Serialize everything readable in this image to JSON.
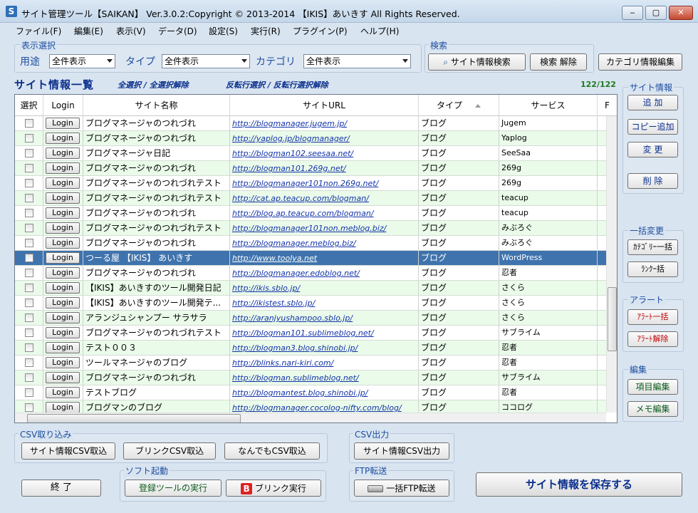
{
  "window": {
    "title": "サイト管理ツール【SAIKAN】 Ver.3.0.2:Copyright © 2013-2014 【IKIS】あいきす All Rights Reserved.",
    "icon_glyph": "S"
  },
  "menu": [
    "ファイル(F)",
    "編集(E)",
    "表示(V)",
    "データ(D)",
    "設定(S)",
    "実行(R)",
    "プラグイン(P)",
    "ヘルプ(H)"
  ],
  "display_select": {
    "group_label": "表示選択",
    "usage_label": "用途",
    "usage_value": "全件表示",
    "type_label": "タイプ",
    "type_value": "全件表示",
    "category_label": "カテゴリ",
    "category_value": "全件表示"
  },
  "search": {
    "group_label": "検索",
    "search_button": "サイト情報検索",
    "clear_button": "検索 解除"
  },
  "category_edit_button": "カテゴリ情報編集",
  "list": {
    "title": "サイト情報一覧",
    "select_all": "全選択 / 全選択解除",
    "invert": "反転行選択 / 反転行選択解除",
    "count": "122/122",
    "columns": [
      "選択",
      "Login",
      "サイト名称",
      "サイトURL",
      "タイプ",
      "サービス",
      "F"
    ],
    "login_label": "Login",
    "rows": [
      {
        "name": "ブログマネージャのつれづれ",
        "url": "http://blogmanager.jugem.jp/",
        "type": "ブログ",
        "service": "Jugem"
      },
      {
        "name": "ブログマネージャのつれづれ",
        "url": "http://yaplog.jp/blogmanager/",
        "type": "ブログ",
        "service": "Yaplog"
      },
      {
        "name": "ブログマネージャ日記",
        "url": "http://blogman102.seesaa.net/",
        "type": "ブログ",
        "service": "SeeSaa"
      },
      {
        "name": "ブログマネージャのつれづれ",
        "url": "http://blogman101.269g.net/",
        "type": "ブログ",
        "service": "269g"
      },
      {
        "name": "ブログマネージャのつれづれテスト",
        "url": "http://blogmanager101non.269g.net/",
        "type": "ブログ",
        "service": "269g"
      },
      {
        "name": "ブログマネージャのつれづれテスト",
        "url": "http://cat.ap.teacup.com/blogman/",
        "type": "ブログ",
        "service": "teacup"
      },
      {
        "name": "ブログマネージャのつれづれ",
        "url": "http://blog.ap.teacup.com/blogman/",
        "type": "ブログ",
        "service": "teacup"
      },
      {
        "name": "ブログマネージャのつれづれテスト",
        "url": "http://blogmanager101non.meblog.biz/",
        "type": "ブログ",
        "service": "みぶろぐ"
      },
      {
        "name": "ブログマネージャのつれづれ",
        "url": "http://blogmanager.meblog.biz/",
        "type": "ブログ",
        "service": "みぶろぐ"
      },
      {
        "name": "つーる屋 【IKIS】 あいきす",
        "url": "http://www.toolya.net",
        "type": "ブログ",
        "service": "WordPress"
      },
      {
        "name": "ブログマネージャのつれづれ",
        "url": "http://blogmanager.edoblog.net/",
        "type": "ブログ",
        "service": "忍者"
      },
      {
        "name": "【IKIS】あいきすのツール開発日記",
        "url": "http://ikis.sblo.jp/",
        "type": "ブログ",
        "service": "さくら"
      },
      {
        "name": "【IKIS】あいきすのツール開発テ...",
        "url": "http://ikistest.sblo.jp/",
        "type": "ブログ",
        "service": "さくら"
      },
      {
        "name": "アランジュシャンプー サラサラ",
        "url": "http://aranjyushampoo.sblo.jp/",
        "type": "ブログ",
        "service": "さくら"
      },
      {
        "name": "ブログマネージャのつれづれテスト",
        "url": "http://blogman101.sublimeblog.net/",
        "type": "ブログ",
        "service": "サブライム"
      },
      {
        "name": "テスト００３",
        "url": "http://blogman3.blog.shinobi.jp/",
        "type": "ブログ",
        "service": "忍者"
      },
      {
        "name": "ツールマネージャのブログ",
        "url": "http://blinks.nari-kiri.com/",
        "type": "ブログ",
        "service": "忍者"
      },
      {
        "name": "ブログマネージャのつれづれ",
        "url": "http://blogman.sublimeblog.net/",
        "type": "ブログ",
        "service": "サブライム"
      },
      {
        "name": "テストブログ",
        "url": "http://blogmantest.blog.shinobi.jp/",
        "type": "ブログ",
        "service": "忍者"
      },
      {
        "name": "ブログマンのブログ",
        "url": "http://blogmanager.cocolog-nifty.com/blog/",
        "type": "ブログ",
        "service": "ココログ"
      }
    ],
    "selected_row_index": 9
  },
  "side": {
    "site_info_label": "サイト情報",
    "add": "追 加",
    "copy_add": "コピー追加",
    "change": "変 更",
    "delete": "削 除",
    "bulk_label": "一括変更",
    "category_bulk": "ｶﾃｺﾞﾘｰ一括",
    "rank_bulk": "ﾗﾝｸｰ括",
    "alert_label": "アラート",
    "alert_bulk": "ｱﾗｰﾄ一括",
    "alert_clear": "ｱﾗｰﾄ解除",
    "edit_label": "編集",
    "item_edit": "項目編集",
    "memo_edit": "メモ編集"
  },
  "csv_import": {
    "label": "CSV取り込み",
    "site_csv": "サイト情報CSV取込",
    "blink_csv": "ブリンクCSV取込",
    "any_csv": "なんでもCSV取込"
  },
  "csv_export": {
    "label": "CSV出力",
    "site_csv": "サイト情報CSV出力"
  },
  "bottom": {
    "exit": "終 了",
    "launch_label": "ソフト起動",
    "register_tool": "登録ツールの実行",
    "blink_run": "ブリンク実行",
    "ftp_label": "FTP転送",
    "ftp_bulk": "一括FTP転送",
    "save": "サイト情報を保存する"
  },
  "colors": {
    "accent": "#0a2e8c",
    "selected_row": "#3f73ad",
    "alt_row": "#eafbea",
    "window_bg": "#d8e4f0"
  }
}
